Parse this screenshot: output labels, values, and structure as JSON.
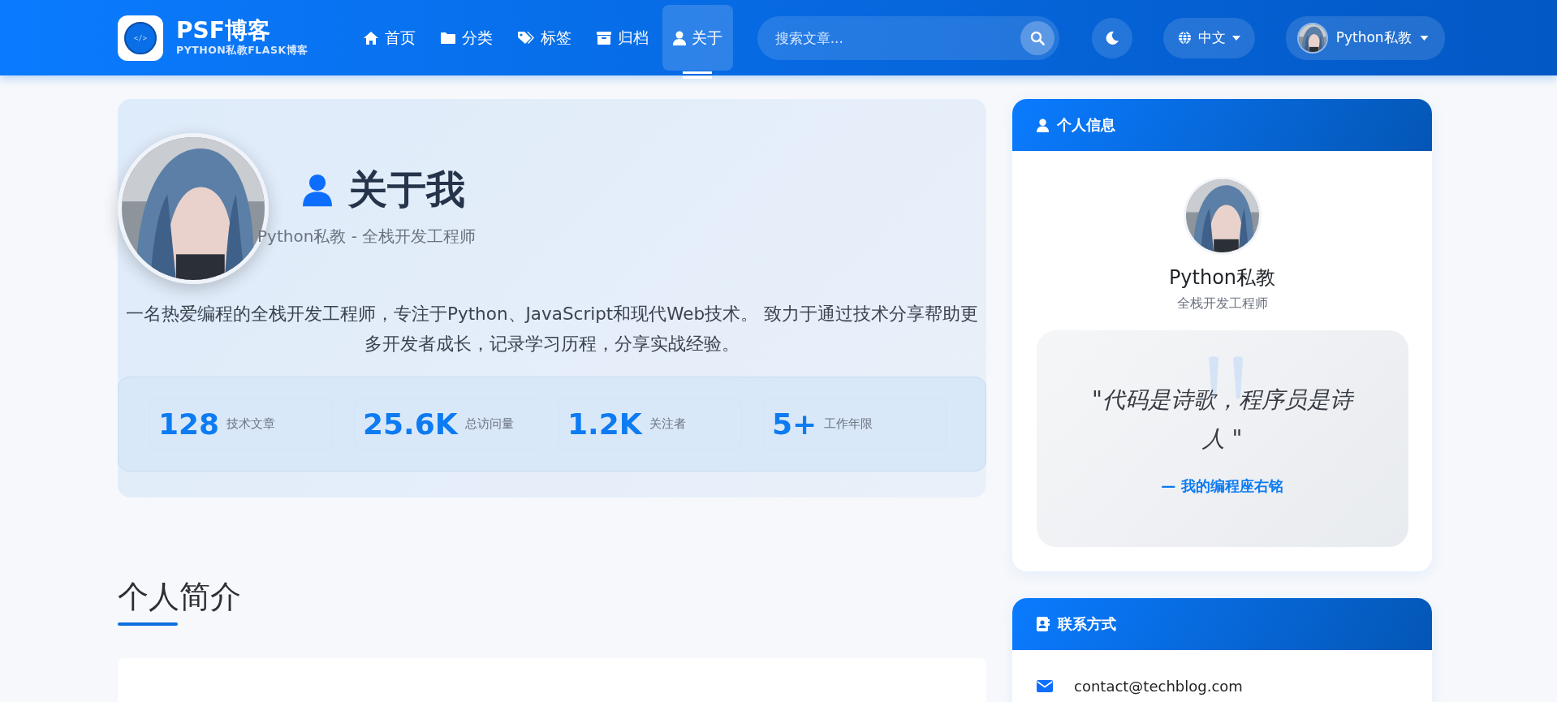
{
  "header": {
    "logo": {
      "glyph": "</>"
    },
    "brand": "PSF博客",
    "tagline": "PYTHON私教FLASK博客",
    "nav": [
      {
        "label": "首页",
        "selected": false
      },
      {
        "label": "分类",
        "selected": false
      },
      {
        "label": "标签",
        "selected": false
      },
      {
        "label": "归档",
        "selected": false
      },
      {
        "label": "关于",
        "selected": true
      }
    ],
    "search": {
      "placeholder": "搜索文章..."
    },
    "language": "中文",
    "user": {
      "name": "Python私教"
    }
  },
  "hero": {
    "title": "关于我",
    "subtitle": "Python私教 - 全栈开发工程师",
    "bio": "一名热爱编程的全栈开发工程师，专注于Python、JavaScript和现代Web技术。 致力于通过技术分享帮助更多开发者成长，记录学习历程，分享实战经验。",
    "stats": [
      {
        "value": "128",
        "label": "技术文章"
      },
      {
        "value": "25.6K",
        "label": "总访问量"
      },
      {
        "value": "1.2K",
        "label": "关注者"
      },
      {
        "value": "5+",
        "label": "工作年限"
      }
    ]
  },
  "section": {
    "title": "个人简介"
  },
  "sidebar": {
    "profile_card": {
      "title": "个人信息",
      "name": "Python私教",
      "role": "全栈开发工程师",
      "quote": "\"代码是诗歌，程序员是诗人 \"",
      "quote_source": "— 我的编程座右铭"
    },
    "contact_card": {
      "title": "联系方式",
      "items": [
        {
          "kind": "email",
          "text": "contact@techblog.com"
        }
      ]
    }
  }
}
